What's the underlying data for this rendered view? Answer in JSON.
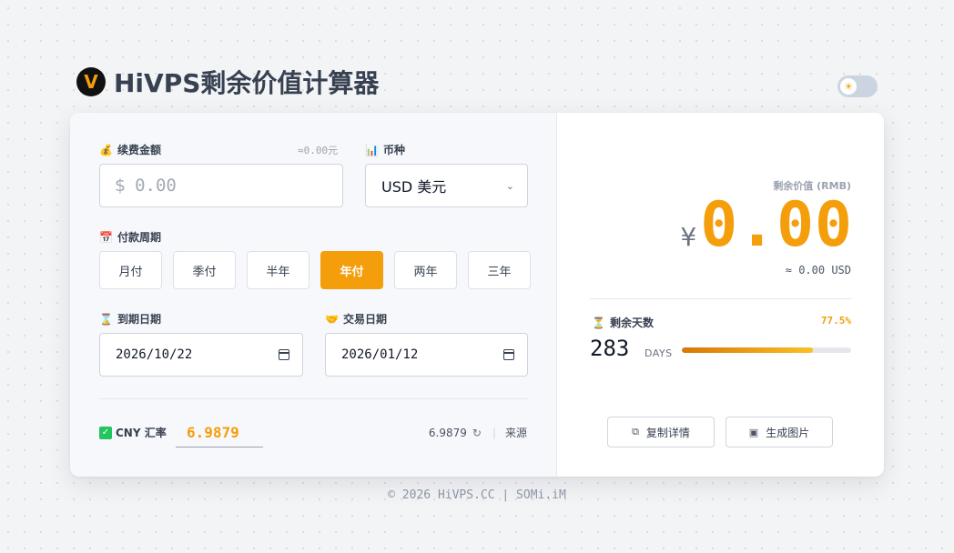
{
  "header": {
    "logo_letter": "V",
    "title": "HiVPS剩余价值计算器",
    "theme_icon": "sun-icon",
    "theme_glyph": "☀"
  },
  "form": {
    "amount": {
      "icon": "💰",
      "label": "续费金额",
      "hint": "≈0.00元",
      "prefix": "$",
      "placeholder": "0.00"
    },
    "currency": {
      "icon": "📊",
      "label": "币种",
      "selected": "USD 美元"
    },
    "period": {
      "icon": "📅",
      "label": "付款周期",
      "options": [
        "月付",
        "季付",
        "半年",
        "年付",
        "两年",
        "三年"
      ],
      "active_index": 3
    },
    "expiry": {
      "icon": "⌛",
      "label": "到期日期",
      "value": "2026/10/22"
    },
    "trade": {
      "icon": "🤝",
      "label": "交易日期",
      "value": "2026/01/12"
    },
    "rate": {
      "icon_glyph": "✓",
      "label": "CNY 汇率",
      "value": "6.9879",
      "reference": "6.9879",
      "refresh_glyph": "↻",
      "source_label": "来源"
    }
  },
  "result": {
    "label": "剩余价值 (RMB)",
    "currency_symbol": "¥",
    "value": "0.00",
    "usd_approx": "≈ 0.00 USD",
    "days": {
      "icon": "⏳",
      "label": "剩余天数",
      "count": "283",
      "unit": "DAYS",
      "percent_label": "77.5%",
      "percent": 77.5
    },
    "copy_label": "复制详情",
    "image_label": "生成图片"
  },
  "footer": {
    "text": "© 2026 HiVPS.CC | SOMi.iM"
  },
  "colors": {
    "accent": "#f59e0b",
    "success": "#22c55e"
  }
}
